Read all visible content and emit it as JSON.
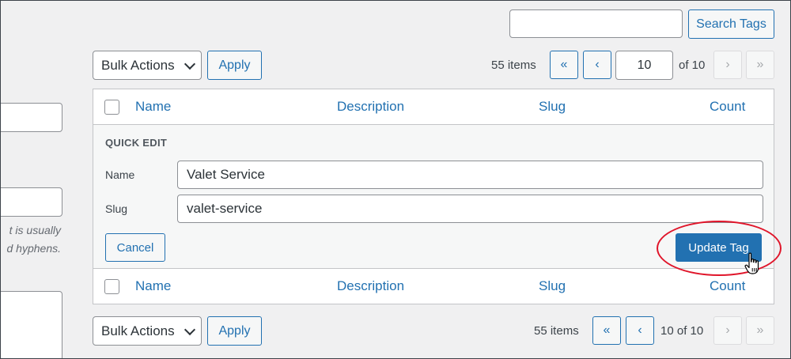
{
  "left_form": {
    "desc_line1": "t is usually",
    "desc_line2": "d hyphens."
  },
  "search": {
    "value": "",
    "button_label": "Search Tags"
  },
  "top_nav": {
    "bulk_actions_label": "Bulk Actions",
    "apply_label": "Apply",
    "items_count": "55 items",
    "first_page": "«",
    "prev_page": "‹",
    "current_page": "10",
    "of_pages": "of 10",
    "next_page": "›",
    "last_page": "»"
  },
  "table": {
    "columns": [
      "Name",
      "Description",
      "Slug",
      "Count"
    ]
  },
  "quick_edit": {
    "title": "QUICK EDIT",
    "name_label": "Name",
    "name_value": "Valet Service",
    "slug_label": "Slug",
    "slug_value": "valet-service",
    "cancel_label": "Cancel",
    "update_label": "Update Tag"
  },
  "bottom_nav": {
    "bulk_actions_label": "Bulk Actions",
    "apply_label": "Apply",
    "items_count": "55 items",
    "first_page": "«",
    "prev_page": "‹",
    "page_text": "10 of 10",
    "next_page": "›",
    "last_page": "»"
  },
  "colors": {
    "link_blue": "#2271b1",
    "highlight_red": "#e0152a"
  }
}
